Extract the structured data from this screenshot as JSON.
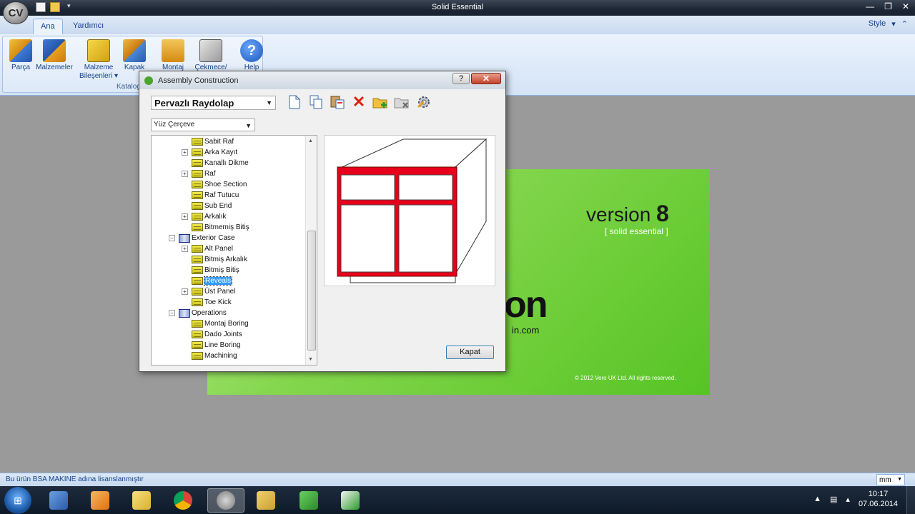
{
  "app": {
    "logo_text": "CV",
    "title": "Solid Essential",
    "window_controls": [
      "—",
      "❐",
      "✕"
    ]
  },
  "ribbon": {
    "tabs": [
      {
        "label": "Ana",
        "active": true
      },
      {
        "label": "Yardımcı",
        "active": false
      }
    ],
    "style_label": "Style",
    "group": {
      "label": "Kataloglar",
      "buttons": [
        {
          "label": "Parça",
          "icon": "part-icon"
        },
        {
          "label": "Malzemeler",
          "icon": "materials-icon"
        },
        {
          "label": "Malzeme Bileşenleri ▾",
          "icon": "material-components-icon"
        },
        {
          "label": "Kapak",
          "icon": "door-icon"
        },
        {
          "label": "Montaj",
          "icon": "assembly-icon"
        },
        {
          "label": "Çekmece/",
          "icon": "drawer-icon"
        },
        {
          "label": "Help",
          "icon": "help-icon"
        }
      ]
    }
  },
  "splash": {
    "version_word": "version",
    "version_number": "8",
    "edition": "[ solid essential ]",
    "logo_fragment": "on",
    "url_fragment": "in.com",
    "copyright": "© 2012 Vero UK Ltd. All rights reserved."
  },
  "dialog": {
    "title": "Assembly Construction",
    "help_label": "?",
    "close_label": "✕",
    "assembly_select": "Pervazlı Raydolap",
    "filter_select": "Yüz Çerçeve",
    "toolbar_icons": [
      "new-icon",
      "copy-icon",
      "paste-icon",
      "delete-icon",
      "add-folder-icon",
      "remove-folder-icon",
      "settings-icon"
    ],
    "tree": [
      {
        "label": "Sabit Raf",
        "level": 2,
        "expander": "",
        "icon": "folder",
        "selected": false
      },
      {
        "label": "Arka Kayıt",
        "level": 2,
        "expander": "+",
        "icon": "folder",
        "selected": false
      },
      {
        "label": "Kanallı Dikme",
        "level": 2,
        "expander": "",
        "icon": "folder",
        "selected": false
      },
      {
        "label": "Raf",
        "level": 2,
        "expander": "+",
        "icon": "folder",
        "selected": false
      },
      {
        "label": "Shoe Section",
        "level": 2,
        "expander": "",
        "icon": "folder",
        "selected": false
      },
      {
        "label": "Raf Tutucu",
        "level": 2,
        "expander": "",
        "icon": "folder",
        "selected": false
      },
      {
        "label": "Sub End",
        "level": 2,
        "expander": "",
        "icon": "folder",
        "selected": false
      },
      {
        "label": "Arkalık",
        "level": 2,
        "expander": "+",
        "icon": "folder",
        "selected": false
      },
      {
        "label": "Bitmemiş Bitiş",
        "level": 2,
        "expander": "",
        "icon": "folder",
        "selected": false
      },
      {
        "label": "Exterior Case",
        "level": 1,
        "expander": "−",
        "icon": "book",
        "selected": false
      },
      {
        "label": "Alt Panel",
        "level": 2,
        "expander": "+",
        "icon": "folder",
        "selected": false
      },
      {
        "label": "Bitmiş Arkalık",
        "level": 2,
        "expander": "",
        "icon": "folder",
        "selected": false
      },
      {
        "label": "Bitmiş Bitiş",
        "level": 2,
        "expander": "",
        "icon": "folder",
        "selected": false
      },
      {
        "label": "Reveals",
        "level": 2,
        "expander": "",
        "icon": "folder",
        "selected": true
      },
      {
        "label": "Üst Panel",
        "level": 2,
        "expander": "+",
        "icon": "folder",
        "selected": false
      },
      {
        "label": "Toe Kick",
        "level": 2,
        "expander": "",
        "icon": "folder",
        "selected": false
      },
      {
        "label": "Operations",
        "level": 1,
        "expander": "−",
        "icon": "book",
        "selected": false
      },
      {
        "label": "Montaj Boring",
        "level": 2,
        "expander": "",
        "icon": "folder",
        "selected": false
      },
      {
        "label": "Dado Joints",
        "level": 2,
        "expander": "",
        "icon": "folder",
        "selected": false
      },
      {
        "label": "Line Boring",
        "level": 2,
        "expander": "",
        "icon": "folder",
        "selected": false
      },
      {
        "label": "Machining",
        "level": 2,
        "expander": "",
        "icon": "folder",
        "selected": false
      }
    ],
    "close_button": "Kapat"
  },
  "statusbar": {
    "license": "Bu ürün BSA MAKINE adına lisanslanmıştır",
    "unit": "mm"
  },
  "taskbar": {
    "apps": [
      "explorer-icon",
      "outlook-icon",
      "folder-icon",
      "chrome-icon",
      "cabinet-vision-icon",
      "file-manager-icon",
      "camtasia-icon",
      "camtasia-editor-icon"
    ],
    "time": "10:17",
    "date": "07.06.2014"
  }
}
